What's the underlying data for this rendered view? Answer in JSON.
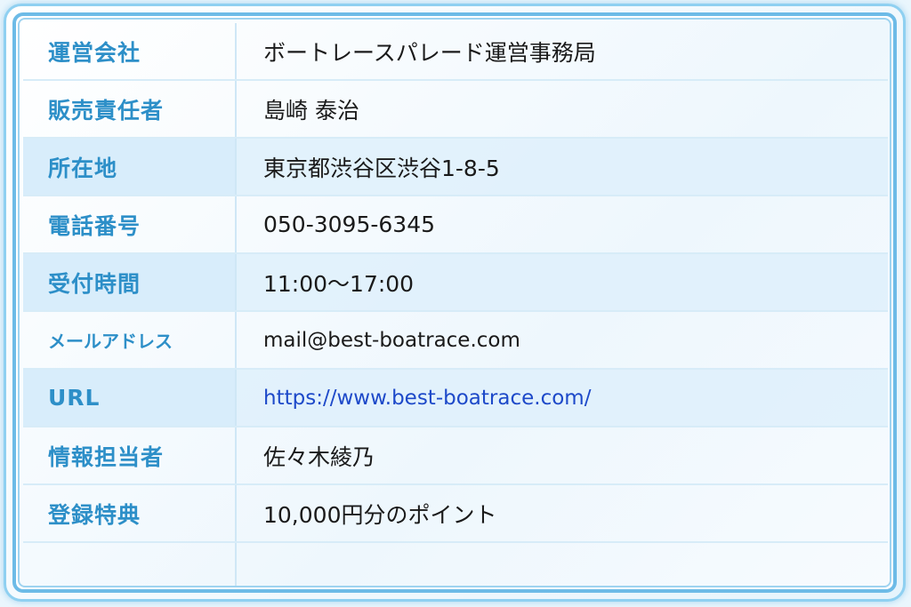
{
  "rows": [
    {
      "label": "運営会社",
      "value": "ボートレースパレード運営事務局"
    },
    {
      "label": "販売責任者",
      "value": "島崎 泰治"
    },
    {
      "label": "所在地",
      "value": "東京都渋谷区渋谷1-8-5"
    },
    {
      "label": "電話番号",
      "value": "050-3095-6345"
    },
    {
      "label": "受付時間",
      "value": "11:00〜17:00"
    },
    {
      "label": "メールアドレス",
      "value": "mail@best-boatrace.com"
    },
    {
      "label": "URL",
      "value": "https://www.best-boatrace.com/"
    },
    {
      "label": "情報担当者",
      "value": "佐々木綾乃"
    },
    {
      "label": "登録特典",
      "value": "10,000円分のポイント"
    }
  ],
  "colors": {
    "label_text": "#2d8fc8",
    "value_text": "#1a1a1a",
    "link_text": "#1d49c9",
    "frame_border": "#6dbbe7",
    "alt_row_bg": "#def0fc"
  }
}
